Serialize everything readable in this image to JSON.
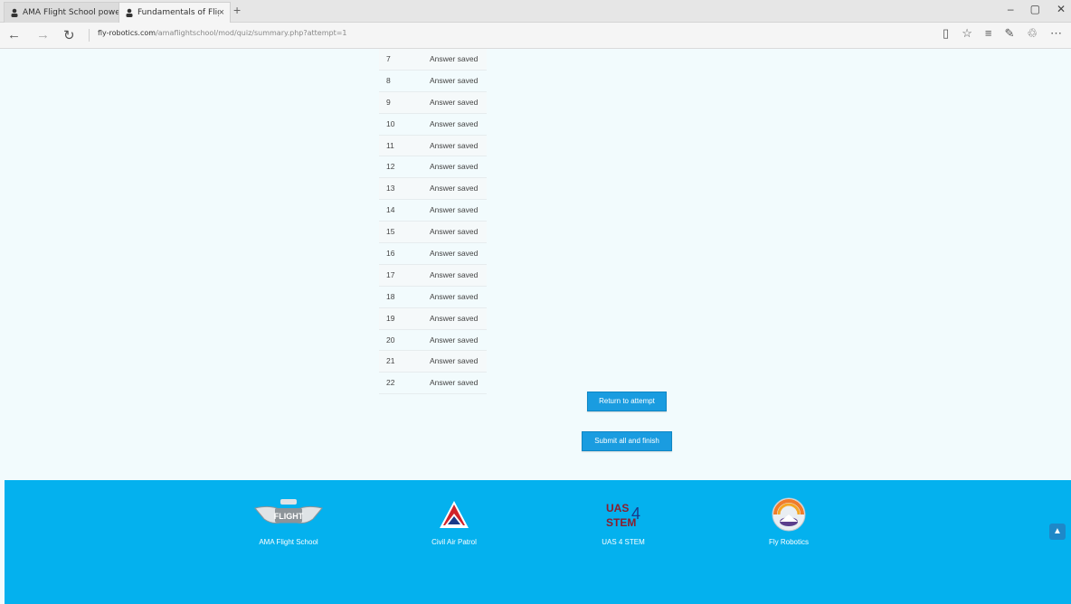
{
  "browser": {
    "tabs": [
      {
        "title": "AMA Flight School powerec"
      },
      {
        "title": "Fundamentals of Flight",
        "close": "×"
      }
    ],
    "new_tab": "+",
    "url_domain": "fly-robotics.com",
    "url_path": "/amaflightschool/mod/quiz/summary.php?attempt=1",
    "window_controls": [
      "–",
      "▢",
      "✕"
    ]
  },
  "summary": {
    "rows": [
      {
        "number": "7",
        "status": "Answer saved"
      },
      {
        "number": "8",
        "status": "Answer saved"
      },
      {
        "number": "9",
        "status": "Answer saved"
      },
      {
        "number": "10",
        "status": "Answer saved"
      },
      {
        "number": "11",
        "status": "Answer saved"
      },
      {
        "number": "12",
        "status": "Answer saved"
      },
      {
        "number": "13",
        "status": "Answer saved"
      },
      {
        "number": "14",
        "status": "Answer saved"
      },
      {
        "number": "15",
        "status": "Answer saved"
      },
      {
        "number": "16",
        "status": "Answer saved"
      },
      {
        "number": "17",
        "status": "Answer saved"
      },
      {
        "number": "18",
        "status": "Answer saved"
      },
      {
        "number": "19",
        "status": "Answer saved"
      },
      {
        "number": "20",
        "status": "Answer saved"
      },
      {
        "number": "21",
        "status": "Answer saved"
      },
      {
        "number": "22",
        "status": "Answer saved"
      }
    ],
    "return_label": "Return to attempt",
    "submit_label": "Submit all and finish"
  },
  "footer": {
    "partners": [
      {
        "name": "AMA Flight School",
        "logo_text": "FLIGHT"
      },
      {
        "name": "Civil Air Patrol"
      },
      {
        "name": "UAS 4 STEM",
        "logo_text": "UAS 4 STEM"
      },
      {
        "name": "Fly Robotics"
      }
    ]
  },
  "colors": {
    "footer": "#04b1ee",
    "button": "#1a9ce0",
    "page_bg": "#f2fbfd"
  }
}
